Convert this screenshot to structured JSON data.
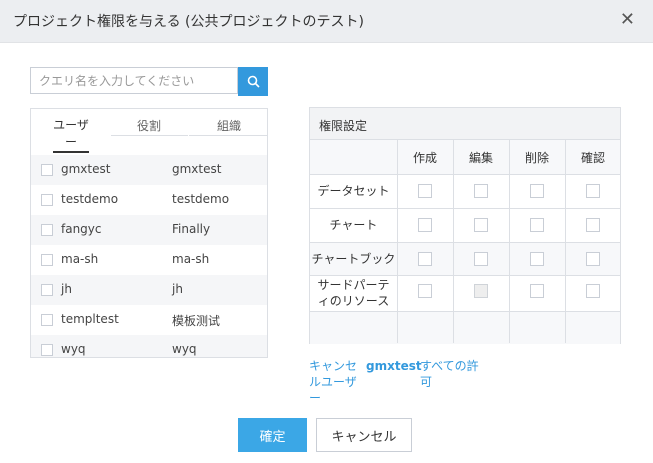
{
  "dialog": {
    "title": "プロジェクト権限を与える (公共プロジェクトのテスト)",
    "close_icon": "close-icon"
  },
  "search": {
    "placeholder": "クエリ名を入力してください",
    "icon": "search-icon"
  },
  "tabs": [
    {
      "label": "ユーザー",
      "active": true
    },
    {
      "label": "役割",
      "active": false
    },
    {
      "label": "組織",
      "active": false
    }
  ],
  "users": [
    {
      "id": "gmxtest",
      "name": "gmxtest"
    },
    {
      "id": "testdemo",
      "name": "testdemo"
    },
    {
      "id": "fangyc",
      "name": "Finally"
    },
    {
      "id": "ma-sh",
      "name": "ma-sh"
    },
    {
      "id": "jh",
      "name": "jh"
    },
    {
      "id": "templtest",
      "name": "模板测试"
    },
    {
      "id": "wyq",
      "name": "wyq"
    }
  ],
  "permissions": {
    "title": "権限設定",
    "columns": [
      "作成",
      "編集",
      "削除",
      "確認"
    ],
    "rows": [
      {
        "label": "データセット",
        "disabled": [
          false,
          false,
          false,
          false
        ]
      },
      {
        "label": "チャート",
        "disabled": [
          false,
          false,
          false,
          false
        ]
      },
      {
        "label": "チャートブック",
        "disabled": [
          false,
          false,
          false,
          false
        ]
      },
      {
        "label": "サードパーティのリソース",
        "disabled": [
          false,
          true,
          false,
          false
        ]
      }
    ]
  },
  "footer_links": {
    "cancel_user": "キャンセルユーザー",
    "selected_user": "gmxtest",
    "all_permissions": "すべての許可"
  },
  "buttons": {
    "confirm": "確定",
    "cancel": "キャンセル"
  },
  "colors": {
    "accent": "#3399dd",
    "header_bg": "#eceef1"
  }
}
